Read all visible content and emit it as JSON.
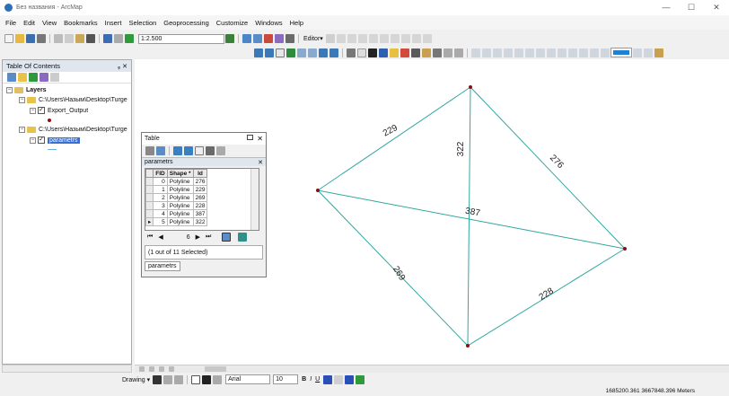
{
  "window": {
    "title": "Без названия - ArcMap",
    "min": "—",
    "max": "☐",
    "close": "✕"
  },
  "menu": [
    "File",
    "Edit",
    "View",
    "Bookmarks",
    "Insert",
    "Selection",
    "Geoprocessing",
    "Customize",
    "Windows",
    "Help"
  ],
  "toolbar": {
    "scale": "1:2.500",
    "editor": "Editor▾"
  },
  "toc": {
    "title": "Table Of Contents",
    "pin": "ᵩ ✕",
    "layers_label": "Layers",
    "items": [
      {
        "type": "folder",
        "label": "C:\\Users\\Назым\\Desktop\\Turge"
      },
      {
        "type": "layer",
        "label": "Export_Output",
        "checked": true
      },
      {
        "type": "folder",
        "label": "C:\\Users\\Назым\\Desktop\\Turge"
      },
      {
        "type": "layer",
        "label": "parametrs",
        "checked": true,
        "selected": true
      }
    ],
    "expander_open": "−",
    "check": "✓"
  },
  "map": {
    "line_color": "#2fa8a0",
    "point_color": "#8b1010",
    "labels": {
      "e0": "229",
      "e1": "322",
      "e2": "276",
      "e3": "387",
      "e4": "269",
      "e5": "228"
    }
  },
  "table": {
    "title": "Table",
    "layer": "parametrs",
    "columns": [
      "FID",
      "Shape *",
      "Id"
    ],
    "rows": [
      [
        "0",
        "Polyline",
        "276"
      ],
      [
        "1",
        "Polyline",
        "229"
      ],
      [
        "2",
        "Polyline",
        "269"
      ],
      [
        "3",
        "Polyline",
        "228"
      ],
      [
        "4",
        "Polyline",
        "387"
      ],
      [
        "5",
        "Polyline",
        "322"
      ]
    ],
    "current_record": "6",
    "nav_first": "⏮",
    "nav_prev": "◀",
    "nav_next": "▶",
    "nav_last": "⏭",
    "selection_info": "(1 out of 11 Selected)",
    "tab_label": "parametrs",
    "close": "✕"
  },
  "drawing": {
    "label": "Drawing ▾",
    "font": "Arial",
    "size": "10"
  },
  "status": {
    "coords": "1685200.361  3667848.396 Meters"
  }
}
